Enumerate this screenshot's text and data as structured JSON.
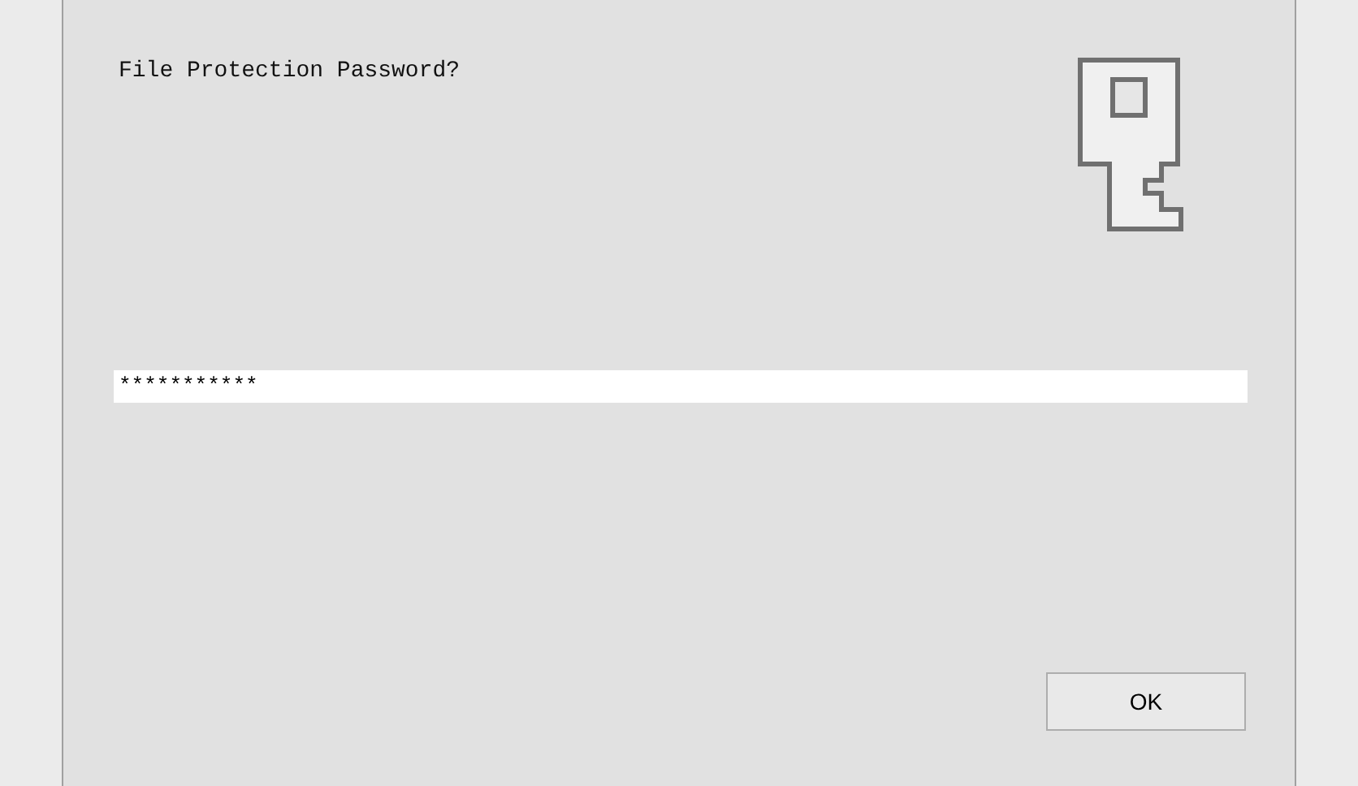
{
  "dialog": {
    "prompt": "File Protection Password?",
    "password": {
      "value": "***********"
    },
    "buttons": [
      {
        "label": "OK"
      }
    ]
  }
}
